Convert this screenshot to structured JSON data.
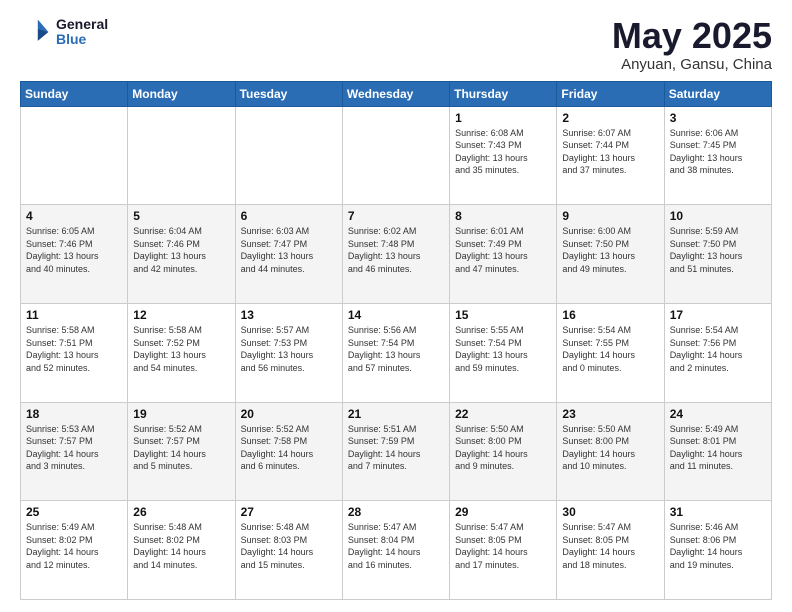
{
  "logo": {
    "general": "General",
    "blue": "Blue"
  },
  "header": {
    "month": "May 2025",
    "location": "Anyuan, Gansu, China"
  },
  "days_of_week": [
    "Sunday",
    "Monday",
    "Tuesday",
    "Wednesday",
    "Thursday",
    "Friday",
    "Saturday"
  ],
  "weeks": [
    [
      {
        "day": "",
        "info": ""
      },
      {
        "day": "",
        "info": ""
      },
      {
        "day": "",
        "info": ""
      },
      {
        "day": "",
        "info": ""
      },
      {
        "day": "1",
        "info": "Sunrise: 6:08 AM\nSunset: 7:43 PM\nDaylight: 13 hours\nand 35 minutes."
      },
      {
        "day": "2",
        "info": "Sunrise: 6:07 AM\nSunset: 7:44 PM\nDaylight: 13 hours\nand 37 minutes."
      },
      {
        "day": "3",
        "info": "Sunrise: 6:06 AM\nSunset: 7:45 PM\nDaylight: 13 hours\nand 38 minutes."
      }
    ],
    [
      {
        "day": "4",
        "info": "Sunrise: 6:05 AM\nSunset: 7:46 PM\nDaylight: 13 hours\nand 40 minutes."
      },
      {
        "day": "5",
        "info": "Sunrise: 6:04 AM\nSunset: 7:46 PM\nDaylight: 13 hours\nand 42 minutes."
      },
      {
        "day": "6",
        "info": "Sunrise: 6:03 AM\nSunset: 7:47 PM\nDaylight: 13 hours\nand 44 minutes."
      },
      {
        "day": "7",
        "info": "Sunrise: 6:02 AM\nSunset: 7:48 PM\nDaylight: 13 hours\nand 46 minutes."
      },
      {
        "day": "8",
        "info": "Sunrise: 6:01 AM\nSunset: 7:49 PM\nDaylight: 13 hours\nand 47 minutes."
      },
      {
        "day": "9",
        "info": "Sunrise: 6:00 AM\nSunset: 7:50 PM\nDaylight: 13 hours\nand 49 minutes."
      },
      {
        "day": "10",
        "info": "Sunrise: 5:59 AM\nSunset: 7:50 PM\nDaylight: 13 hours\nand 51 minutes."
      }
    ],
    [
      {
        "day": "11",
        "info": "Sunrise: 5:58 AM\nSunset: 7:51 PM\nDaylight: 13 hours\nand 52 minutes."
      },
      {
        "day": "12",
        "info": "Sunrise: 5:58 AM\nSunset: 7:52 PM\nDaylight: 13 hours\nand 54 minutes."
      },
      {
        "day": "13",
        "info": "Sunrise: 5:57 AM\nSunset: 7:53 PM\nDaylight: 13 hours\nand 56 minutes."
      },
      {
        "day": "14",
        "info": "Sunrise: 5:56 AM\nSunset: 7:54 PM\nDaylight: 13 hours\nand 57 minutes."
      },
      {
        "day": "15",
        "info": "Sunrise: 5:55 AM\nSunset: 7:54 PM\nDaylight: 13 hours\nand 59 minutes."
      },
      {
        "day": "16",
        "info": "Sunrise: 5:54 AM\nSunset: 7:55 PM\nDaylight: 14 hours\nand 0 minutes."
      },
      {
        "day": "17",
        "info": "Sunrise: 5:54 AM\nSunset: 7:56 PM\nDaylight: 14 hours\nand 2 minutes."
      }
    ],
    [
      {
        "day": "18",
        "info": "Sunrise: 5:53 AM\nSunset: 7:57 PM\nDaylight: 14 hours\nand 3 minutes."
      },
      {
        "day": "19",
        "info": "Sunrise: 5:52 AM\nSunset: 7:57 PM\nDaylight: 14 hours\nand 5 minutes."
      },
      {
        "day": "20",
        "info": "Sunrise: 5:52 AM\nSunset: 7:58 PM\nDaylight: 14 hours\nand 6 minutes."
      },
      {
        "day": "21",
        "info": "Sunrise: 5:51 AM\nSunset: 7:59 PM\nDaylight: 14 hours\nand 7 minutes."
      },
      {
        "day": "22",
        "info": "Sunrise: 5:50 AM\nSunset: 8:00 PM\nDaylight: 14 hours\nand 9 minutes."
      },
      {
        "day": "23",
        "info": "Sunrise: 5:50 AM\nSunset: 8:00 PM\nDaylight: 14 hours\nand 10 minutes."
      },
      {
        "day": "24",
        "info": "Sunrise: 5:49 AM\nSunset: 8:01 PM\nDaylight: 14 hours\nand 11 minutes."
      }
    ],
    [
      {
        "day": "25",
        "info": "Sunrise: 5:49 AM\nSunset: 8:02 PM\nDaylight: 14 hours\nand 12 minutes."
      },
      {
        "day": "26",
        "info": "Sunrise: 5:48 AM\nSunset: 8:02 PM\nDaylight: 14 hours\nand 14 minutes."
      },
      {
        "day": "27",
        "info": "Sunrise: 5:48 AM\nSunset: 8:03 PM\nDaylight: 14 hours\nand 15 minutes."
      },
      {
        "day": "28",
        "info": "Sunrise: 5:47 AM\nSunset: 8:04 PM\nDaylight: 14 hours\nand 16 minutes."
      },
      {
        "day": "29",
        "info": "Sunrise: 5:47 AM\nSunset: 8:05 PM\nDaylight: 14 hours\nand 17 minutes."
      },
      {
        "day": "30",
        "info": "Sunrise: 5:47 AM\nSunset: 8:05 PM\nDaylight: 14 hours\nand 18 minutes."
      },
      {
        "day": "31",
        "info": "Sunrise: 5:46 AM\nSunset: 8:06 PM\nDaylight: 14 hours\nand 19 minutes."
      }
    ]
  ]
}
